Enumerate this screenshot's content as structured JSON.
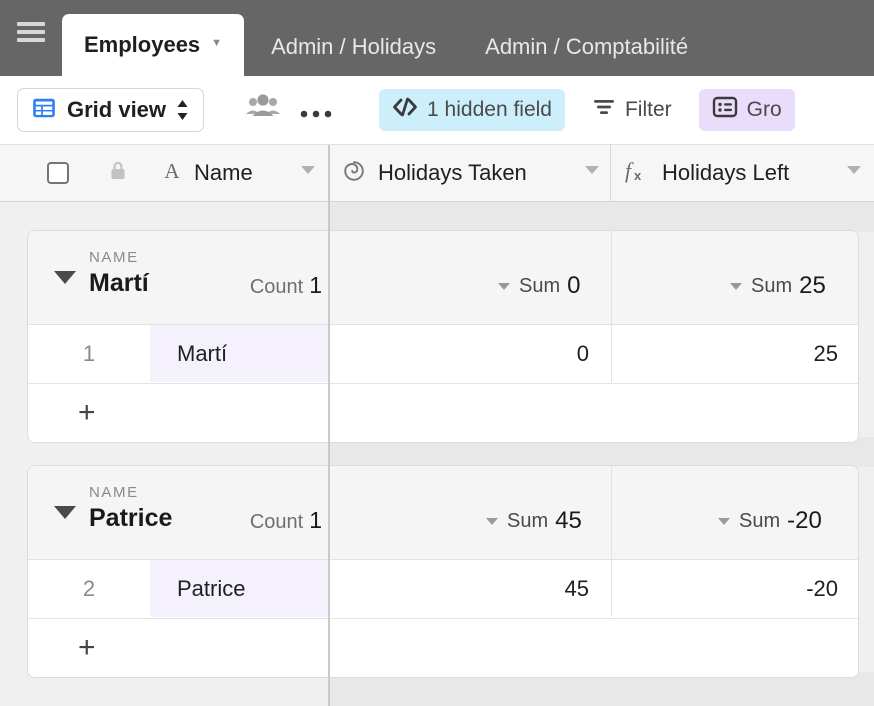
{
  "tabbar": {
    "menu_icon": "hamburger-icon",
    "tabs": [
      {
        "label": "Employees",
        "active": true,
        "caret": "▾"
      },
      {
        "label": "Admin / Holidays",
        "active": false
      },
      {
        "label": "Admin / Comptabilité",
        "active": false
      }
    ]
  },
  "toolbar": {
    "view_icon": "grid-icon",
    "view_label": "Grid view",
    "view_accent_color": "#2d7ff9",
    "collaborators_icon": "people-icon",
    "more_icon": "ellipsis-icon",
    "hidden_fields": {
      "icon": "hidden-fields-icon",
      "label": "1 hidden field",
      "bg": "#cdeffb"
    },
    "filter": {
      "icon": "filter-icon",
      "label": "Filter"
    },
    "group": {
      "icon": "group-icon",
      "label": "Gro",
      "bg": "#e9ddfb"
    }
  },
  "columns": [
    {
      "name": "Name",
      "type_icon": "text-field-icon",
      "glyph": "A"
    },
    {
      "name": "Holidays Taken",
      "type_icon": "rollup-spiral-icon",
      "glyph": "spiral"
    },
    {
      "name": "Holidays Left",
      "type_icon": "formula-fx-icon",
      "glyph": "fx"
    }
  ],
  "header_row": {
    "select_all_icon": "checkbox-icon",
    "lock_icon": "lock-icon"
  },
  "groups": [
    {
      "field_label": "NAME",
      "value": "Martí",
      "count_label": "Count",
      "count_value": "1",
      "agg_taken_label": "Sum",
      "agg_taken_value": "0",
      "agg_left_label": "Sum",
      "agg_left_value": "25",
      "rows": [
        {
          "num": "1",
          "name": "Martí",
          "holidays_taken": "0",
          "holidays_left": "25"
        }
      ],
      "add_row_icon": "plus-icon"
    },
    {
      "field_label": "NAME",
      "value": "Patrice",
      "count_label": "Count",
      "count_value": "1",
      "agg_taken_label": "Sum",
      "agg_taken_value": "45",
      "agg_left_label": "Sum",
      "agg_left_value": "-20",
      "rows": [
        {
          "num": "2",
          "name": "Patrice",
          "holidays_taken": "45",
          "holidays_left": "-20"
        }
      ],
      "add_row_icon": "plus-icon"
    }
  ]
}
